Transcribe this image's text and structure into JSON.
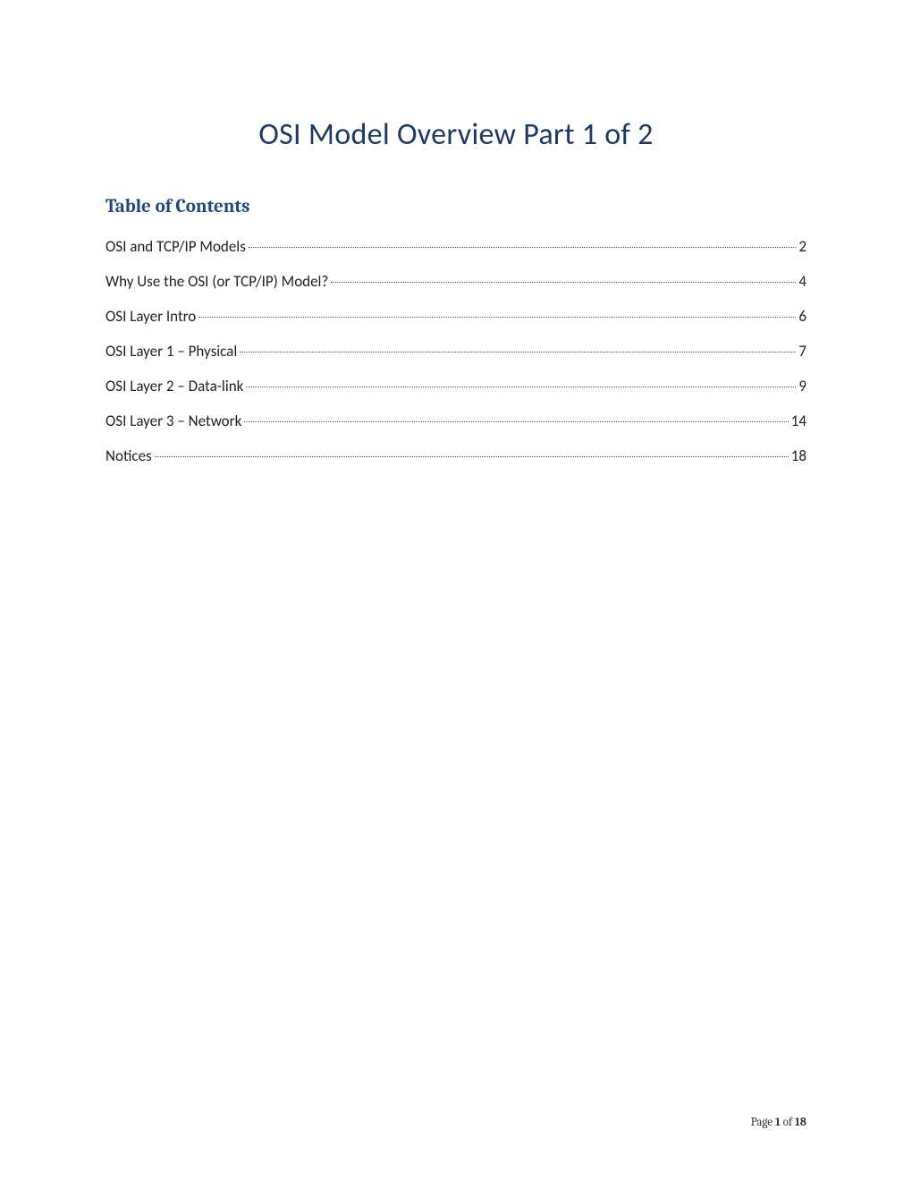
{
  "title": "OSI Model Overview Part 1 of 2",
  "toc_heading": "Table of Contents",
  "toc": [
    {
      "label": "OSI and TCP/IP Models",
      "page": "2"
    },
    {
      "label": "Why Use the OSI (or TCP/IP) Model?",
      "page": "4"
    },
    {
      "label": "OSI Layer Intro",
      "page": "6"
    },
    {
      "label": "OSI Layer 1 – Physical",
      "page": "7"
    },
    {
      "label": "OSI Layer 2 – Data-link",
      "page": "9"
    },
    {
      "label": "OSI Layer 3 – Network",
      "page": "14"
    },
    {
      "label": "Notices",
      "page": "18"
    }
  ],
  "footer": {
    "prefix": "Page ",
    "current": "1",
    "of": " of ",
    "total": "18"
  }
}
